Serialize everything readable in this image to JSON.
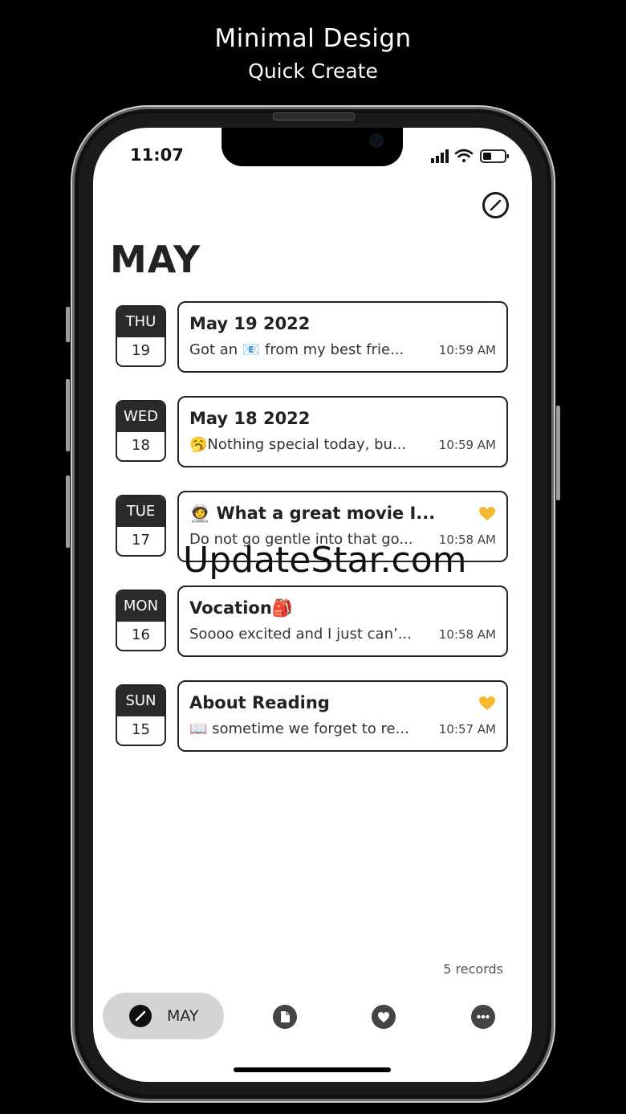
{
  "promo": {
    "title": "Minimal Design",
    "subtitle": "Quick Create"
  },
  "status_bar": {
    "time": "11:07"
  },
  "header": {
    "month": "MAY",
    "edit_icon": "pencil-circle-icon"
  },
  "entries": [
    {
      "dow": "THU",
      "day": "19",
      "title": "May 19 2022",
      "preview": "Got an 📧 from my best frie...",
      "time": "10:59 AM",
      "favorite": false
    },
    {
      "dow": "WED",
      "day": "18",
      "title": "May 18 2022",
      "preview": "🥱Nothing special today, bu...",
      "time": "10:59 AM",
      "favorite": false
    },
    {
      "dow": "TUE",
      "day": "17",
      "title": "🧑‍🚀 What a great movie I...",
      "preview": "Do not go gentle into that go...",
      "time": "10:58 AM",
      "favorite": true
    },
    {
      "dow": "MON",
      "day": "16",
      "title": "Vocation🎒",
      "preview": "Soooo excited and I just can’...",
      "time": "10:58 AM",
      "favorite": false
    },
    {
      "dow": "SUN",
      "day": "15",
      "title": "About Reading",
      "preview": "📖 sometime we forget to re...",
      "time": "10:57 AM",
      "favorite": true
    }
  ],
  "footer": {
    "records": "5 records"
  },
  "tabbar": {
    "active_label": "MAY",
    "tabs": [
      "pencil-icon",
      "document-icon",
      "heart-icon",
      "more-icon"
    ]
  },
  "watermark": "UpdateStar.com",
  "colors": {
    "favorite": "#F5B830",
    "badge_dark": "#2A2A2A",
    "tab_active_bg": "#D4D4D4"
  }
}
